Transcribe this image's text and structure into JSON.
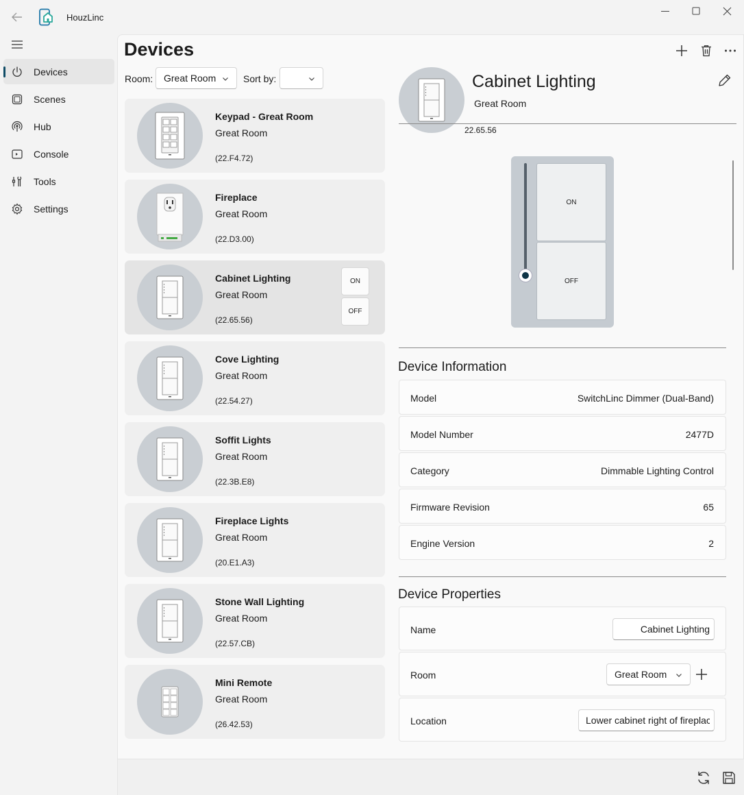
{
  "app": {
    "title": "HouzLinc"
  },
  "sidebar": {
    "items": [
      {
        "label": "Devices",
        "icon": "power-icon",
        "active": true
      },
      {
        "label": "Scenes",
        "icon": "scenes-icon"
      },
      {
        "label": "Hub",
        "icon": "hub-icon"
      },
      {
        "label": "Console",
        "icon": "console-icon"
      },
      {
        "label": "Tools",
        "icon": "tools-icon"
      },
      {
        "label": "Settings",
        "icon": "gear-icon"
      }
    ]
  },
  "page": {
    "title": "Devices"
  },
  "filters": {
    "room_label": "Room:",
    "room_value": "Great Room",
    "sort_label": "Sort by:",
    "sort_value": ""
  },
  "devices": [
    {
      "name": "Keypad - Great Room",
      "room": "Great Room",
      "address": "(22.F4.72)",
      "kind": "keypad"
    },
    {
      "name": "Fireplace",
      "room": "Great Room",
      "address": "(22.D3.00)",
      "kind": "outlet"
    },
    {
      "name": "Cabinet Lighting",
      "room": "Great Room",
      "address": "(22.65.56)",
      "kind": "dimmer",
      "selected": true,
      "on_label": "ON",
      "off_label": "OFF"
    },
    {
      "name": "Cove Lighting",
      "room": "Great Room",
      "address": "(22.54.27)",
      "kind": "dimmer"
    },
    {
      "name": "Soffit Lights",
      "room": "Great Room",
      "address": "(22.3B.E8)",
      "kind": "dimmer"
    },
    {
      "name": "Fireplace Lights",
      "room": "Great Room",
      "address": "(20.E1.A3)",
      "kind": "dimmer"
    },
    {
      "name": "Stone Wall Lighting",
      "room": "Great Room",
      "address": "(22.57.CB)",
      "kind": "dimmer"
    },
    {
      "name": "Mini Remote",
      "room": "Great Room",
      "address": "(26.42.53)",
      "kind": "remote"
    }
  ],
  "detail": {
    "name": "Cabinet Lighting",
    "room": "Great Room",
    "address": "22.65.56",
    "on_label": "ON",
    "off_label": "OFF",
    "level": 0,
    "info_title": "Device Information",
    "info": [
      {
        "key": "Model",
        "value": "SwitchLinc Dimmer (Dual-Band)"
      },
      {
        "key": "Model Number",
        "value": "2477D"
      },
      {
        "key": "Category",
        "value": "Dimmable Lighting Control"
      },
      {
        "key": "Firmware Revision",
        "value": "65"
      },
      {
        "key": "Engine Version",
        "value": "2"
      }
    ],
    "props_title": "Device Properties",
    "props": {
      "name_label": "Name",
      "name_value": "Cabinet Lighting",
      "room_label": "Room",
      "room_value": "Great Room",
      "location_label": "Location",
      "location_value": "Lower cabinet right of fireplac"
    }
  },
  "colors": {
    "accent": "#0f4c66",
    "thumb_bg": "#c9ced3",
    "switch_frame": "#c5cbd1"
  }
}
